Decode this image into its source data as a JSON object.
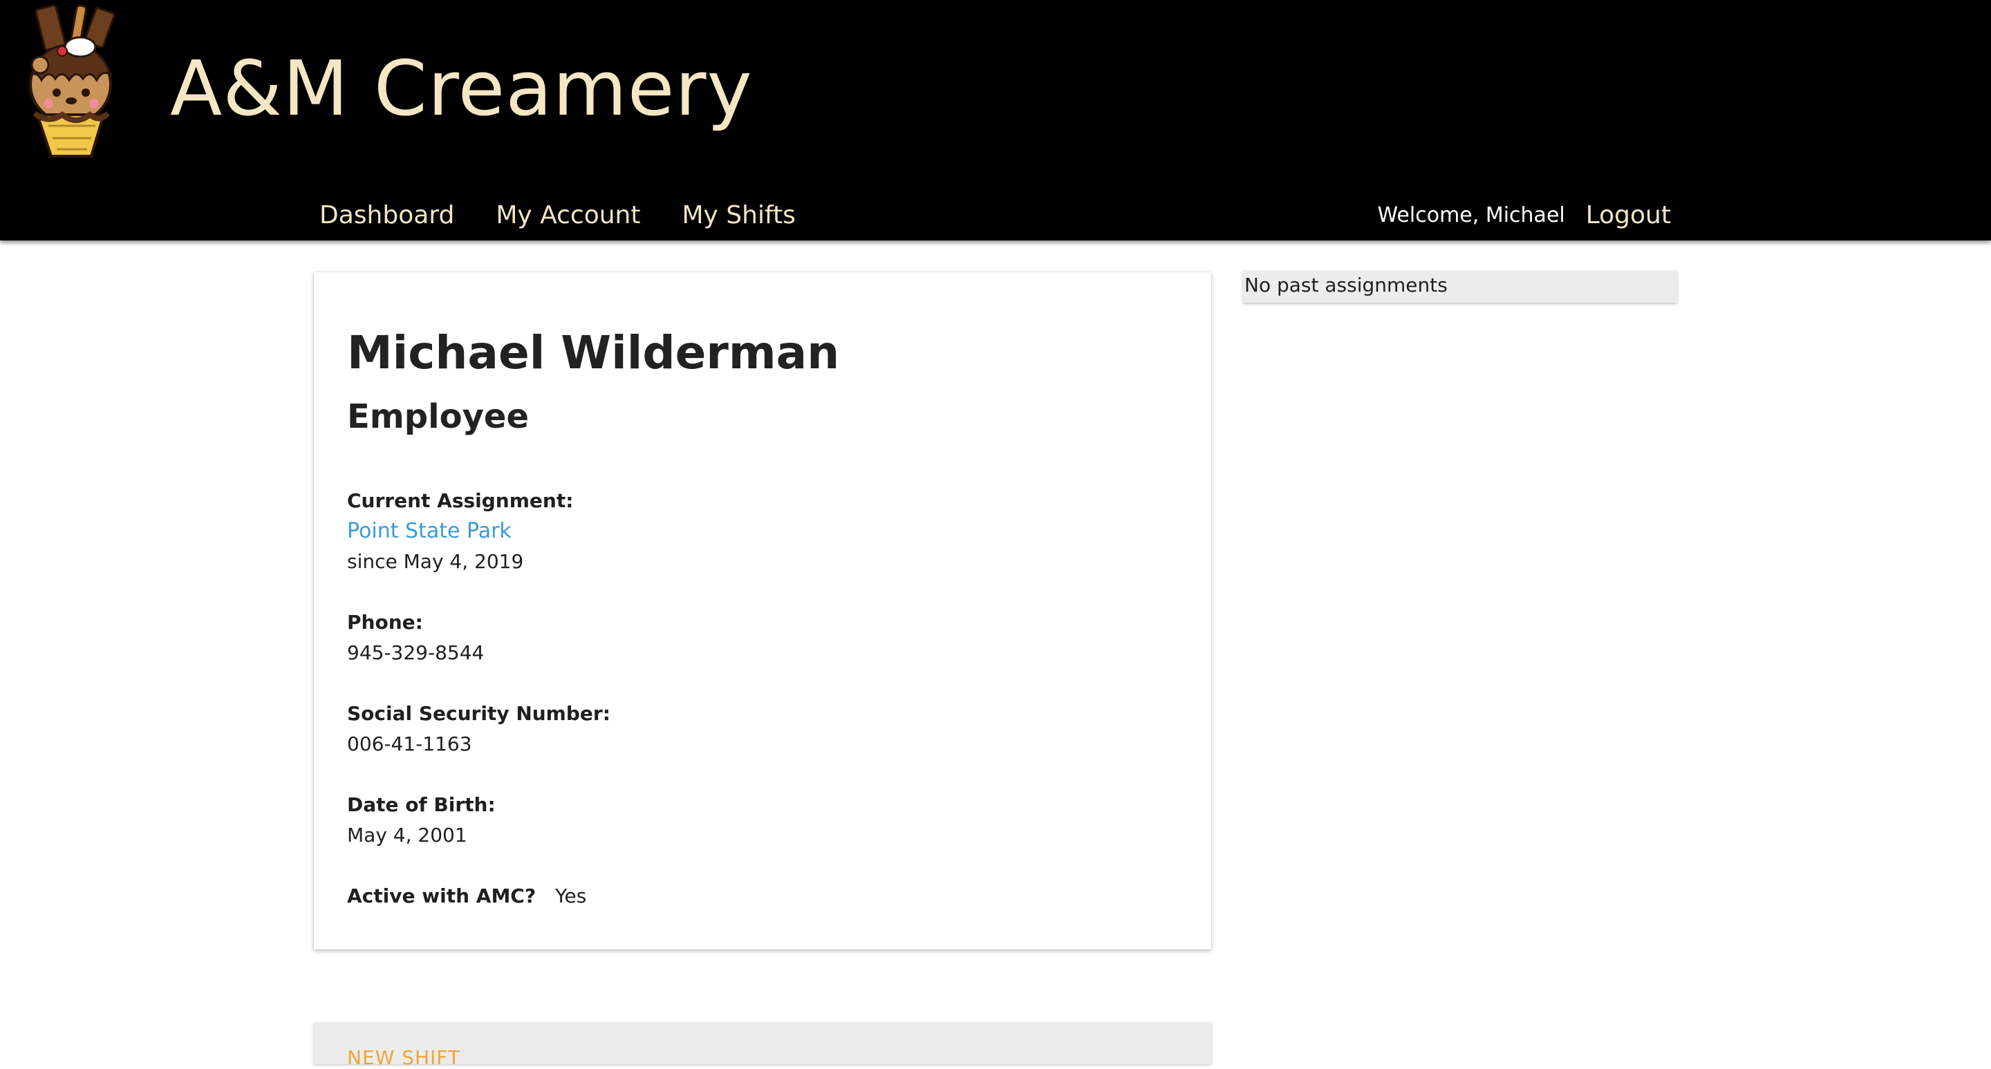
{
  "header": {
    "brand": "A&M Creamery",
    "logo_icon": "ice-cream-sundae-logo-icon",
    "nav": [
      "Dashboard",
      "My Account",
      "My Shifts"
    ],
    "welcome": "Welcome, Michael",
    "logout": "Logout"
  },
  "employee": {
    "name": "Michael Wilderman",
    "role": "Employee",
    "assignment_label": "Current Assignment:",
    "assignment_store": "Point State Park",
    "assignment_since": "since May 4, 2019",
    "phone_label": "Phone:",
    "phone": "945-329-8544",
    "ssn_label": "Social Security Number:",
    "ssn": "006-41-1163",
    "dob_label": "Date of Birth:",
    "dob": "May 4, 2001",
    "active_label": "Active with AMC?",
    "active": "Yes"
  },
  "sidebar": {
    "past_assignments": "No past assignments"
  },
  "next_card": {
    "title": "NEW SHIFT"
  },
  "colors": {
    "topbar": "#000000",
    "brand_cream": "#f5e6c4",
    "link_blue": "#3b9ad9",
    "card_grey": "#ececec",
    "accent_orange": "#f0a43a"
  }
}
